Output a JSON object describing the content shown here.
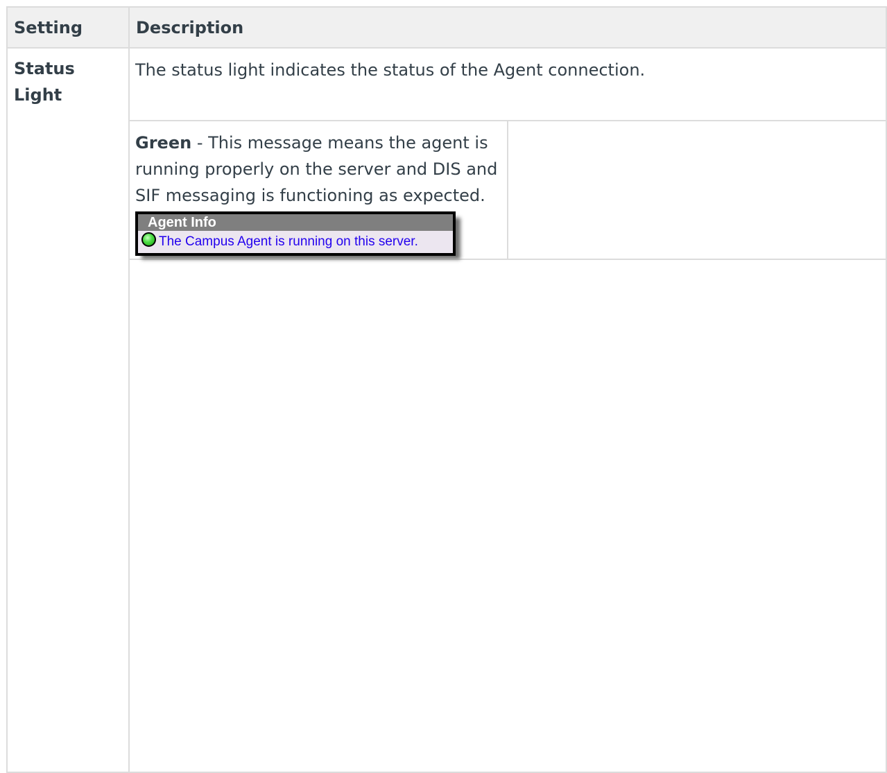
{
  "table": {
    "headers": {
      "setting": "Setting",
      "description": "Description"
    },
    "rows": [
      {
        "setting": "Status Light",
        "description": "The status light indicates the status of the Agent connection.",
        "states": [
          {
            "label": "Green",
            "text": " - This message means the agent is running properly on the server and DIS and SIF messaging is functioning as expected.",
            "widget": {
              "header": "Agent Info",
              "message": "The Campus Agent is running on this server.",
              "light_color": "#33cc33",
              "message_color": "#2200ee",
              "icon": "green-status-light-icon"
            }
          }
        ]
      }
    ]
  }
}
